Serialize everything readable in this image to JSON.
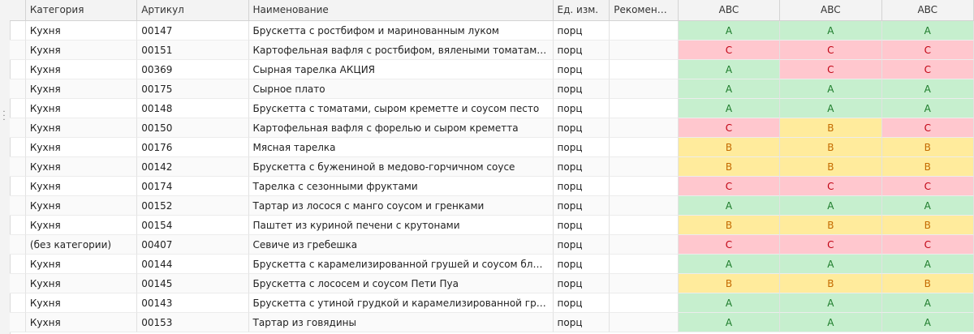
{
  "columns": {
    "category": "Категория",
    "article": "Артикул",
    "name": "Наименование",
    "unit": "Ед. изм.",
    "recommended": "Рекомендованная цена",
    "abc1": "ABC",
    "abc2": "ABC",
    "abc3": "ABC"
  },
  "abc_colors": {
    "A": {
      "bg": "#c6efce",
      "fg": "#1a7a28"
    },
    "B": {
      "bg": "#ffeb9c",
      "fg": "#c46a00"
    },
    "C": {
      "bg": "#ffc7ce",
      "fg": "#c00010"
    }
  },
  "rows": [
    {
      "category": "Кухня",
      "article": "00147",
      "name": "Брускетта с ростбифом и маринованным луком",
      "unit": "порц",
      "recommended": "",
      "abc": [
        "A",
        "A",
        "A"
      ]
    },
    {
      "category": "Кухня",
      "article": "00151",
      "name": "Картофельная вафля с ростбифом, вялеными томатами и соусом",
      "unit": "порц",
      "recommended": "",
      "abc": [
        "C",
        "C",
        "C"
      ]
    },
    {
      "category": "Кухня",
      "article": "00369",
      "name": "Сырная тарелка АКЦИЯ",
      "unit": "порц",
      "recommended": "",
      "abc": [
        "A",
        "C",
        "C"
      ]
    },
    {
      "category": "Кухня",
      "article": "00175",
      "name": "Сырное плато",
      "unit": "порц",
      "recommended": "",
      "abc": [
        "A",
        "A",
        "A"
      ]
    },
    {
      "category": "Кухня",
      "article": "00148",
      "name": "Брускетта с томатами, сыром креметте и соусом песто",
      "unit": "порц",
      "recommended": "",
      "abc": [
        "A",
        "A",
        "A"
      ]
    },
    {
      "category": "Кухня",
      "article": "00150",
      "name": "Картофельная вафля с форелью и сыром креметта",
      "unit": "порц",
      "recommended": "",
      "abc": [
        "C",
        "B",
        "C"
      ]
    },
    {
      "category": "Кухня",
      "article": "00176",
      "name": "Мясная тарелка",
      "unit": "порц",
      "recommended": "",
      "abc": [
        "B",
        "B",
        "B"
      ]
    },
    {
      "category": "Кухня",
      "article": "00142",
      "name": "Брускетта с бужениной в медово-горчичном соусе",
      "unit": "порц",
      "recommended": "",
      "abc": [
        "B",
        "B",
        "B"
      ]
    },
    {
      "category": "Кухня",
      "article": "00174",
      "name": "Тарелка с сезонными фруктами",
      "unit": "порц",
      "recommended": "",
      "abc": [
        "C",
        "C",
        "C"
      ]
    },
    {
      "category": "Кухня",
      "article": "00152",
      "name": "Тартар из лосося с манго соусом и гренками",
      "unit": "порц",
      "recommended": "",
      "abc": [
        "A",
        "A",
        "A"
      ]
    },
    {
      "category": "Кухня",
      "article": "00154",
      "name": "Паштет из куриной печени с крутонами",
      "unit": "порц",
      "recommended": "",
      "abc": [
        "B",
        "B",
        "B"
      ]
    },
    {
      "category": "(без категории)",
      "article": "00407",
      "name": "Севиче из гребешка",
      "unit": "порц",
      "recommended": "",
      "abc": [
        "C",
        "C",
        "C"
      ]
    },
    {
      "category": "Кухня",
      "article": "00144",
      "name": "Брускетта с карамелизированной грушей и соусом блю-чиз",
      "unit": "порц",
      "recommended": "",
      "abc": [
        "A",
        "A",
        "A"
      ]
    },
    {
      "category": "Кухня",
      "article": "00145",
      "name": "Брускетта с лососем и соусом Пети Пуа",
      "unit": "порц",
      "recommended": "",
      "abc": [
        "B",
        "B",
        "B"
      ]
    },
    {
      "category": "Кухня",
      "article": "00143",
      "name": "Брускетта с утиной грудкой и карамелизированной грушей",
      "unit": "порц",
      "recommended": "",
      "abc": [
        "A",
        "A",
        "A"
      ]
    },
    {
      "category": "Кухня",
      "article": "00153",
      "name": "Тартар из говядины",
      "unit": "порц",
      "recommended": "",
      "abc": [
        "A",
        "A",
        "A"
      ]
    }
  ]
}
